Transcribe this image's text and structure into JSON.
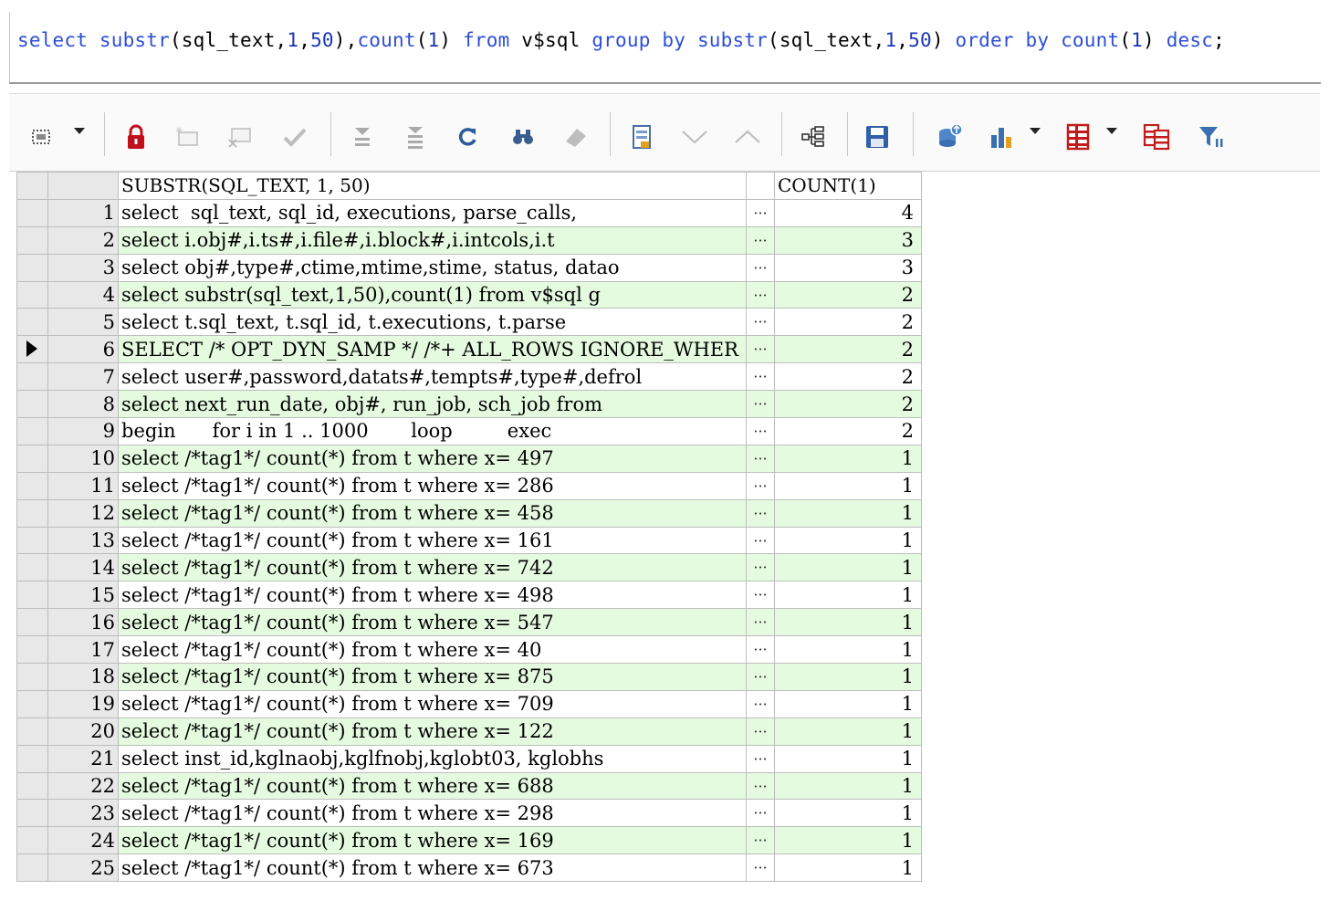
{
  "editor": {
    "sql": [
      {
        "t": "select",
        "k": "kw"
      },
      {
        "t": " ",
        "k": "tx"
      },
      {
        "t": "substr",
        "k": "kw"
      },
      {
        "t": "(sql_text,",
        "k": "tx"
      },
      {
        "t": "1",
        "k": "nm"
      },
      {
        "t": ",",
        "k": "tx"
      },
      {
        "t": "50",
        "k": "nm"
      },
      {
        "t": "),",
        "k": "tx"
      },
      {
        "t": "count",
        "k": "kw"
      },
      {
        "t": "(",
        "k": "tx"
      },
      {
        "t": "1",
        "k": "nm"
      },
      {
        "t": ") ",
        "k": "tx"
      },
      {
        "t": "from",
        "k": "kw"
      },
      {
        "t": " v$sql ",
        "k": "tx"
      },
      {
        "t": "group by",
        "k": "kw"
      },
      {
        "t": " ",
        "k": "tx"
      },
      {
        "t": "substr",
        "k": "kw"
      },
      {
        "t": "(sql_text,",
        "k": "tx"
      },
      {
        "t": "1",
        "k": "nm"
      },
      {
        "t": ",",
        "k": "tx"
      },
      {
        "t": "50",
        "k": "nm"
      },
      {
        "t": ") ",
        "k": "tx"
      },
      {
        "t": "order by",
        "k": "kw"
      },
      {
        "t": " ",
        "k": "tx"
      },
      {
        "t": "count",
        "k": "kw"
      },
      {
        "t": "(",
        "k": "tx"
      },
      {
        "t": "1",
        "k": "nm"
      },
      {
        "t": ") ",
        "k": "tx"
      },
      {
        "t": "desc",
        "k": "kw"
      },
      {
        "t": ";",
        "k": "tx"
      }
    ]
  },
  "toolbar": {
    "icons": [
      "grid-select-icon",
      "lock-icon",
      "add-record-icon",
      "delete-record-icon",
      "post-record-icon",
      "fetch-next-icon",
      "fetch-all-icon",
      "refresh-icon",
      "find-icon",
      "clear-icon",
      "single-record-icon",
      "sort-down-icon",
      "sort-up-icon",
      "query-by-example-icon",
      "save-icon",
      "export-icon",
      "chart-icon",
      "table-view-icon",
      "compare-icon",
      "filter-icon"
    ]
  },
  "grid": {
    "columns": [
      "SUBSTR(SQL_TEXT, 1, 50)",
      "COUNT(1)"
    ],
    "ellipsis": "···",
    "selected_row": 6,
    "rows": [
      {
        "n": "1",
        "text": "select  sql_text, sql_id, executions, parse_calls,",
        "count": "4"
      },
      {
        "n": "2",
        "text": "select i.obj#,i.ts#,i.file#,i.block#,i.intcols,i.t",
        "count": "3"
      },
      {
        "n": "3",
        "text": "select obj#,type#,ctime,mtime,stime, status, datao",
        "count": "3"
      },
      {
        "n": "4",
        "text": "select substr(sql_text,1,50),count(1) from v$sql g",
        "count": "2"
      },
      {
        "n": "5",
        "text": "select t.sql_text, t.sql_id, t.executions, t.parse",
        "count": "2"
      },
      {
        "n": "6",
        "text": "SELECT /* OPT_DYN_SAMP */ /*+ ALL_ROWS IGNORE_WHER",
        "count": "2"
      },
      {
        "n": "7",
        "text": "select user#,password,datats#,tempts#,type#,defrol",
        "count": "2"
      },
      {
        "n": "8",
        "text": "select next_run_date, obj#, run_job, sch_job from",
        "count": "2"
      },
      {
        "n": "9",
        "text": "begin      for i in 1 .. 1000       loop         exec",
        "count": "2"
      },
      {
        "n": "10",
        "text": "select /*tag1*/ count(*) from t where x= 497",
        "count": "1"
      },
      {
        "n": "11",
        "text": "select /*tag1*/ count(*) from t where x= 286",
        "count": "1"
      },
      {
        "n": "12",
        "text": "select /*tag1*/ count(*) from t where x= 458",
        "count": "1"
      },
      {
        "n": "13",
        "text": "select /*tag1*/ count(*) from t where x= 161",
        "count": "1"
      },
      {
        "n": "14",
        "text": "select /*tag1*/ count(*) from t where x= 742",
        "count": "1"
      },
      {
        "n": "15",
        "text": "select /*tag1*/ count(*) from t where x= 498",
        "count": "1"
      },
      {
        "n": "16",
        "text": "select /*tag1*/ count(*) from t where x= 547",
        "count": "1"
      },
      {
        "n": "17",
        "text": "select /*tag1*/ count(*) from t where x= 40",
        "count": "1"
      },
      {
        "n": "18",
        "text": "select /*tag1*/ count(*) from t where x= 875",
        "count": "1"
      },
      {
        "n": "19",
        "text": "select /*tag1*/ count(*) from t where x= 709",
        "count": "1"
      },
      {
        "n": "20",
        "text": "select /*tag1*/ count(*) from t where x= 122",
        "count": "1"
      },
      {
        "n": "21",
        "text": "select inst_id,kglnaobj,kglfnobj,kglobt03, kglobhs",
        "count": "1"
      },
      {
        "n": "22",
        "text": "select /*tag1*/ count(*) from t where x= 688",
        "count": "1"
      },
      {
        "n": "23",
        "text": "select /*tag1*/ count(*) from t where x= 298",
        "count": "1"
      },
      {
        "n": "24",
        "text": "select /*tag1*/ count(*) from t where x= 169",
        "count": "1"
      },
      {
        "n": "25",
        "text": "select /*tag1*/ count(*) from t where x= 673",
        "count": "1"
      }
    ]
  }
}
